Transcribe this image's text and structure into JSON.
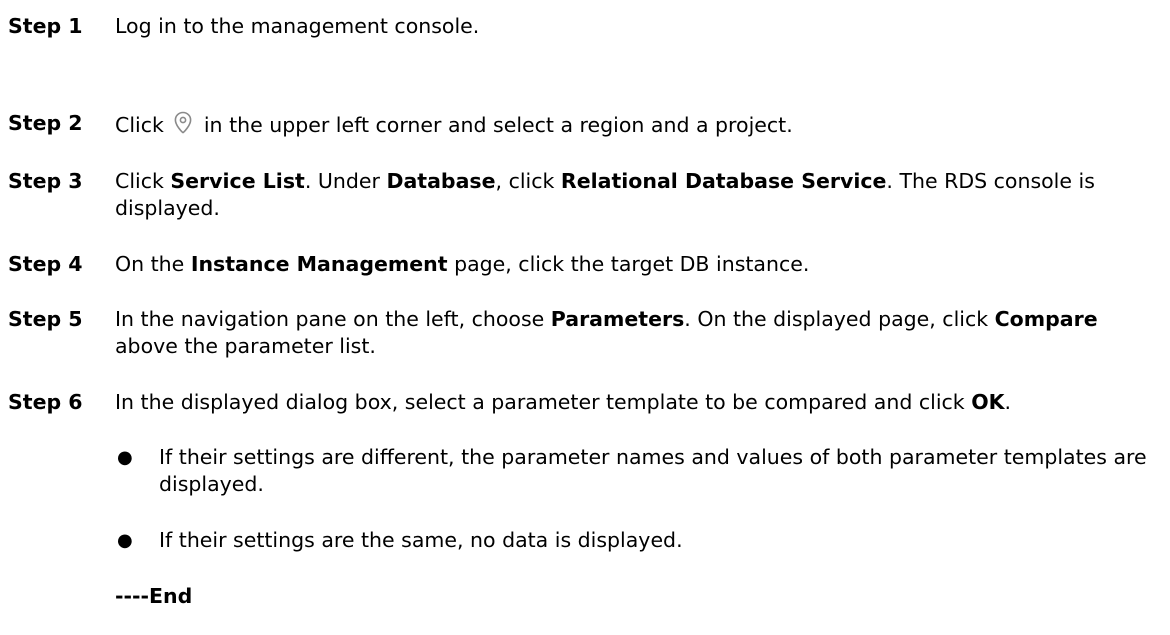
{
  "steps": [
    {
      "label": "Step 1",
      "parts": [
        {
          "text": "Log in to the management console.",
          "bold": false
        }
      ]
    },
    {
      "label": "Step 2",
      "parts_before_icon": "Click",
      "icon": "location-pin-icon",
      "parts_after_icon": "in the upper left corner and select a region and a project."
    },
    {
      "label": "Step 3",
      "parts": [
        {
          "text": "Click ",
          "bold": false
        },
        {
          "text": "Service List",
          "bold": true
        },
        {
          "text": ". Under ",
          "bold": false
        },
        {
          "text": "Database",
          "bold": true
        },
        {
          "text": ", click ",
          "bold": false
        },
        {
          "text": "Relational Database Service",
          "bold": true
        },
        {
          "text": ". The RDS console is displayed.",
          "bold": false
        }
      ]
    },
    {
      "label": "Step 4",
      "parts": [
        {
          "text": "On the ",
          "bold": false
        },
        {
          "text": "Instance Management",
          "bold": true
        },
        {
          "text": " page, click the target DB instance.",
          "bold": false
        }
      ]
    },
    {
      "label": "Step 5",
      "parts": [
        {
          "text": "In the navigation pane on the left, choose ",
          "bold": false
        },
        {
          "text": "Parameters",
          "bold": true
        },
        {
          "text": ". On the displayed page, click ",
          "bold": false
        },
        {
          "text": "Compare",
          "bold": true
        },
        {
          "text": " above the parameter list.",
          "bold": false
        }
      ]
    },
    {
      "label": "Step 6",
      "parts": [
        {
          "text": "In the displayed dialog box, select a parameter template to be compared and click ",
          "bold": false
        },
        {
          "text": "OK",
          "bold": true
        },
        {
          "text": ".",
          "bold": false
        }
      ]
    }
  ],
  "bullets": [
    {
      "marker": "●",
      "text": "If their settings are different, the parameter names and values of both parameter templates are displayed."
    },
    {
      "marker": "●",
      "text": "If their settings are the same, no data is displayed."
    }
  ],
  "end_mark": "----End",
  "colors": {
    "text": "#000000",
    "icon_stroke": "#8a8a8a"
  }
}
